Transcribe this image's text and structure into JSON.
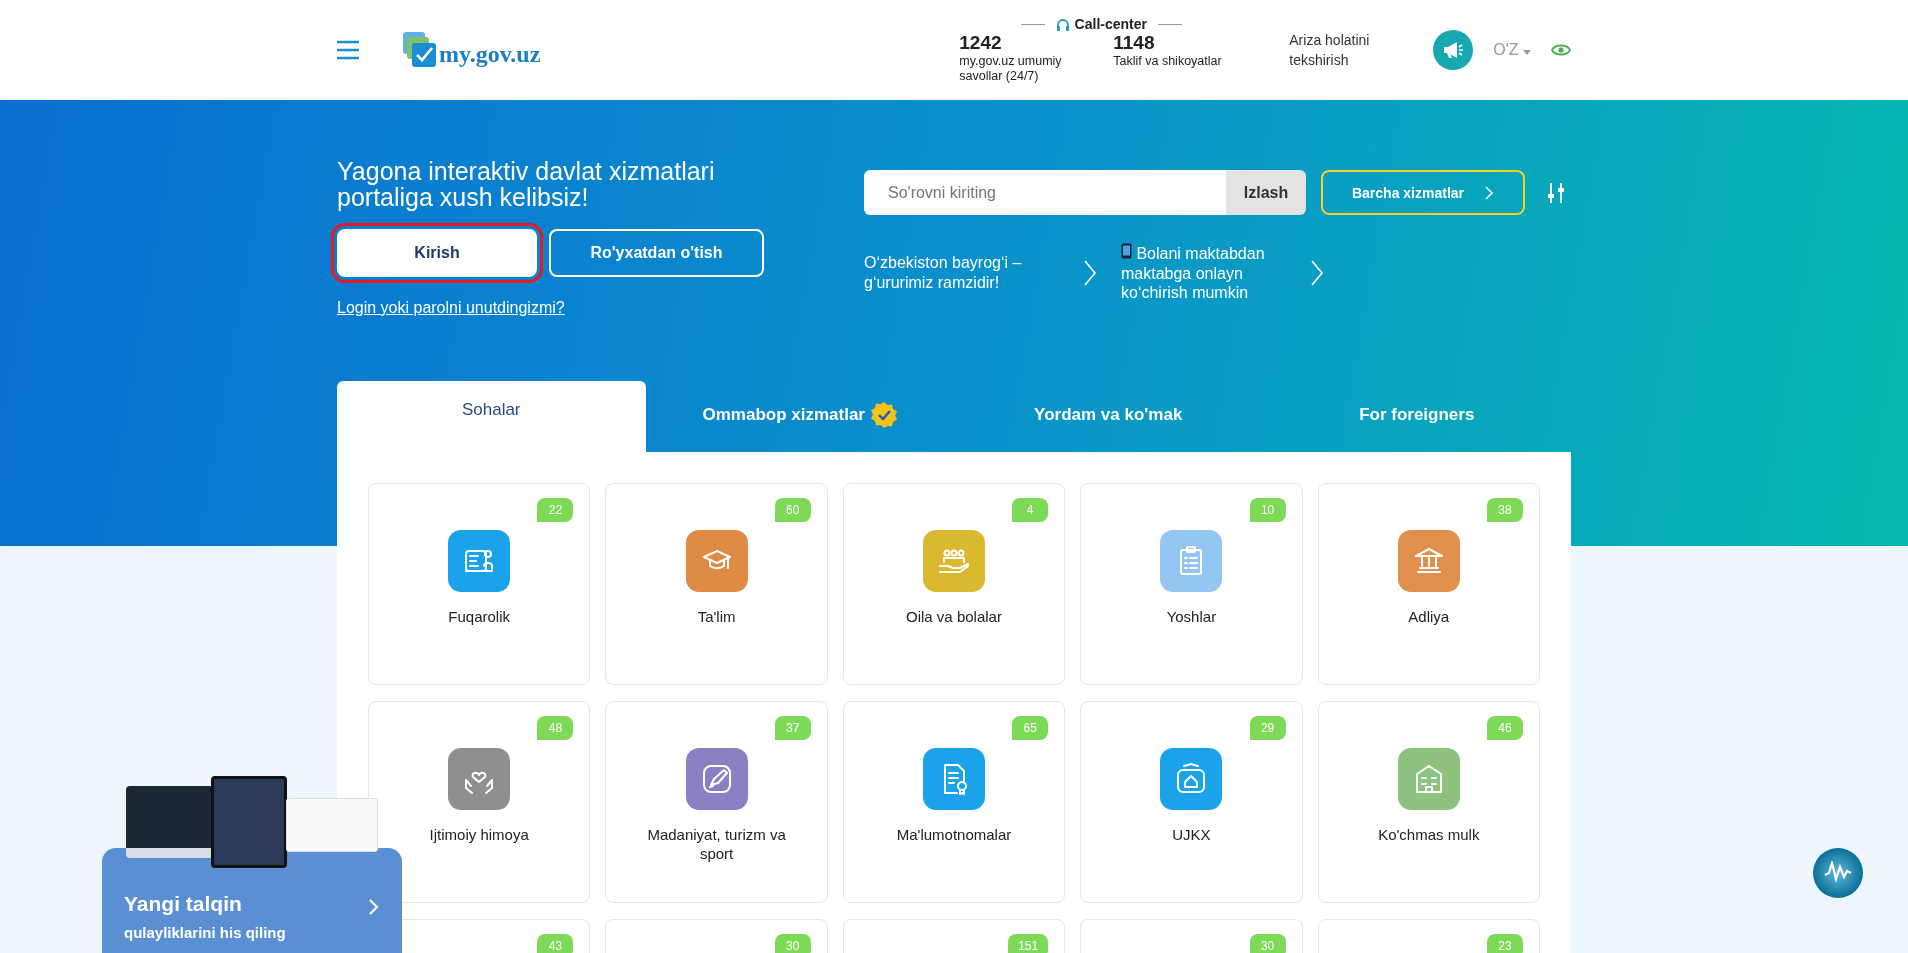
{
  "header": {
    "logo_text": "my.gov.uz",
    "call_center": {
      "title": "Call-center",
      "lines": [
        {
          "number": "1242",
          "label": "my.gov.uz umumiy savollar (24/7)"
        },
        {
          "number": "1148",
          "label": "Taklif va shikoyatlar"
        }
      ]
    },
    "status_link": "Ariza holatini tekshirish",
    "language": "O'Z"
  },
  "hero": {
    "title": "Yagona interaktiv davlat xizmatlari portaliga xush kelibsiz!",
    "login_button": {
      "label": "Kirish",
      "highlighted": true
    },
    "register_button": "Ro'yxatdan o'tish",
    "forgot_link": "Login yoki parolni unutdingizmi?",
    "search": {
      "placeholder": "So'rovni kiriting",
      "button": "Izlash"
    },
    "all_services_button": "Barcha xizmatlar",
    "news": [
      {
        "kind": "plain",
        "text": "Oʻzbekiston bayrogʻi – gʻururimiz ramzidir!"
      },
      {
        "kind": "phone",
        "text": "Bolani maktabdan maktabga onlayn koʻchirish mumkin"
      }
    ]
  },
  "tabs": [
    {
      "label": "Sohalar",
      "selected": true,
      "verified": false
    },
    {
      "label": "Ommabop xizmatlar",
      "selected": false,
      "verified": true
    },
    {
      "label": "Yordam va ko'mak",
      "selected": false,
      "verified": false
    },
    {
      "label": "For foreigners",
      "selected": false,
      "verified": false
    }
  ],
  "categories": [
    {
      "name": "Fuqarolik",
      "count": "22",
      "color": "#1aa3e8"
    },
    {
      "name": "Ta'lim",
      "count": "60",
      "color": "#e08b45"
    },
    {
      "name": "Oila va bolalar",
      "count": "4",
      "color": "#dbb92f"
    },
    {
      "name": "Yoshlar",
      "count": "10",
      "color": "#93c6f0"
    },
    {
      "name": "Adliya",
      "count": "38",
      "color": "#e08f4c"
    },
    {
      "name": "Ijtimoiy himoya",
      "count": "48",
      "color": "#8f8f8f"
    },
    {
      "name": "Madaniyat, turizm va sport",
      "count": "37",
      "color": "#8b80c4"
    },
    {
      "name": "Ma'lumotnomalar",
      "count": "65",
      "color": "#1aa3e8"
    },
    {
      "name": "UJKX",
      "count": "29",
      "color": "#1aa3e8"
    },
    {
      "name": "Ko'chmas mulk",
      "count": "46",
      "color": "#8dc27f"
    },
    {
      "count": "43"
    },
    {
      "count": "30"
    },
    {
      "count": "151"
    },
    {
      "count": "30"
    },
    {
      "count": "23"
    }
  ],
  "promo": {
    "title": "Yangi talqin",
    "subtitle": "qulayliklarini his qiling"
  }
}
